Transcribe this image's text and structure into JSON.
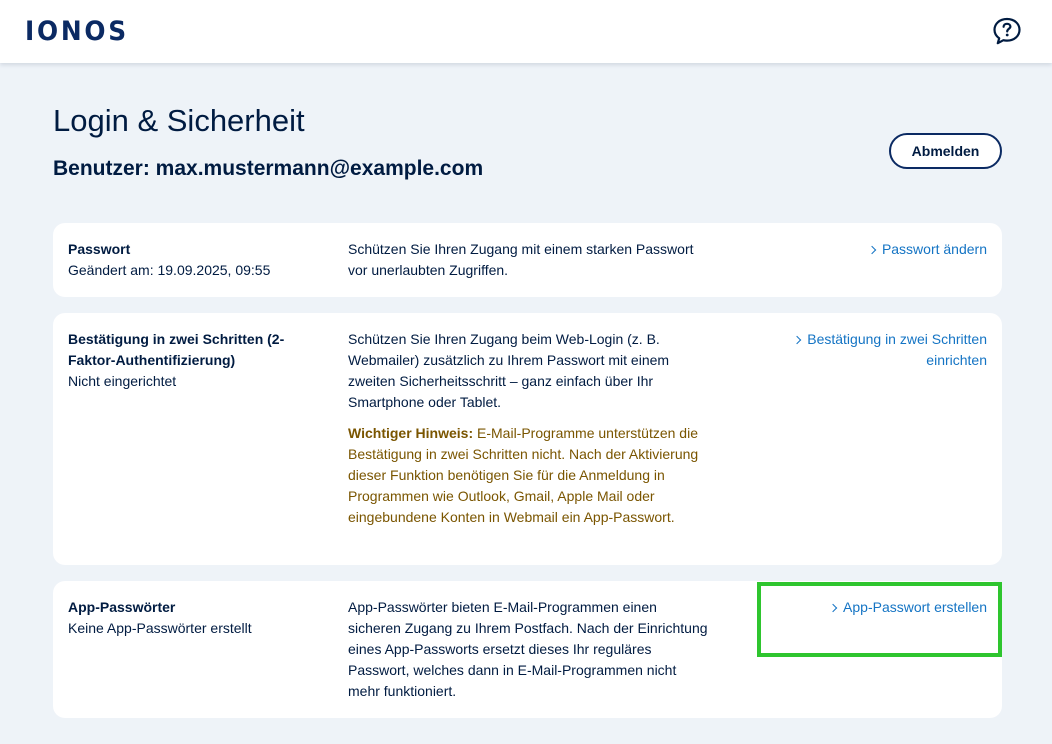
{
  "header": {
    "logo_text": "IONOS",
    "help_icon": "chat-question-icon"
  },
  "page": {
    "title": "Login & Sicherheit",
    "user_line": "Benutzer: max.mustermann@example.com",
    "logout_label": "Abmelden"
  },
  "cards": [
    {
      "title": "Passwort",
      "status": "Geändert am: 19.09.2025, 09:55",
      "description": "Schützen Sie Ihren Zugang mit einem starken Passwort vor unerlaubten Zugriffen.",
      "action": "Passwort ändern"
    },
    {
      "title": "Bestätigung in zwei Schritten (2-Faktor-Authentifizierung)",
      "status": "Nicht eingerichtet",
      "description": "Schützen Sie Ihren Zugang beim Web-Login (z. B. Webmailer) zusätzlich zu Ihrem Passwort mit einem zweiten Sicherheitsschritt – ganz einfach über Ihr Smartphone oder Tablet.",
      "note_label": "Wichtiger Hinweis:",
      "note_text": " E-Mail-Programme unterstützen die Bestätigung in zwei Schritten nicht. Nach der Aktivierung dieser Funktion benötigen Sie für die Anmeldung in Programmen wie Outlook, Gmail, Apple Mail oder eingebundene Konten in Webmail ein App-Passwort.",
      "action": "Bestätigung in zwei Schritten einrichten"
    },
    {
      "title": "App-Passwörter",
      "status": "Keine App-Passwörter erstellt",
      "description": "App-Passwörter bieten E-Mail-Programmen einen sicheren Zugang zu Ihrem Postfach. Nach der Einrichtung eines App-Passworts ersetzt dieses Ihr reguläres Passwort, welches dann in E-Mail-Programmen nicht mehr funktioniert.",
      "action": "App-Passwort erstellen"
    }
  ],
  "colors": {
    "brand": "#0b2a63",
    "link": "#1474c4",
    "warning_text": "#7a5500",
    "highlight": "#2ec52e",
    "background": "#eef3f8"
  }
}
